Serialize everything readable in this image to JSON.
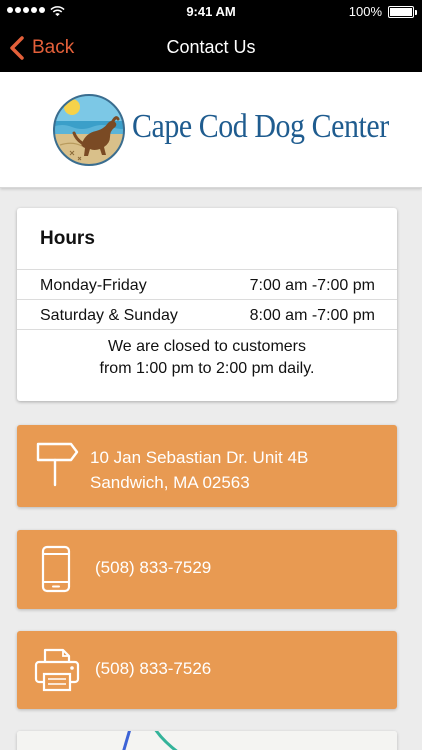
{
  "status_bar": {
    "time": "9:41 AM",
    "battery": "100%",
    "icons": [
      "signal-dots-icon",
      "wifi-icon",
      "battery-icon"
    ]
  },
  "nav": {
    "back_label": "Back",
    "title": "Contact Us",
    "accent_color": "#e4603a",
    "icons": [
      "chevron-left-icon"
    ]
  },
  "logo": {
    "text": "Cape Cod Dog Center",
    "text_color": "#1f5c8f"
  },
  "hours": {
    "title": "Hours",
    "rows": [
      {
        "day": "Monday-Friday",
        "time": "7:00 am -7:00 pm"
      },
      {
        "day": "Saturday & Sunday",
        "time": "8:00 am -7:00 pm"
      }
    ],
    "note_line1": "We are closed to customers",
    "note_line2": "from 1:00 pm to 2:00 pm daily."
  },
  "contact": {
    "card_color": "#e89a52",
    "address": {
      "icon": "signpost-icon",
      "line1": "10 Jan Sebastian Dr. Unit 4B",
      "line2": "Sandwich, MA 02563"
    },
    "phone": {
      "icon": "phone-icon",
      "number": "(508) 833-7529"
    },
    "fax": {
      "icon": "fax-icon",
      "number": "(508) 833-7526"
    }
  }
}
